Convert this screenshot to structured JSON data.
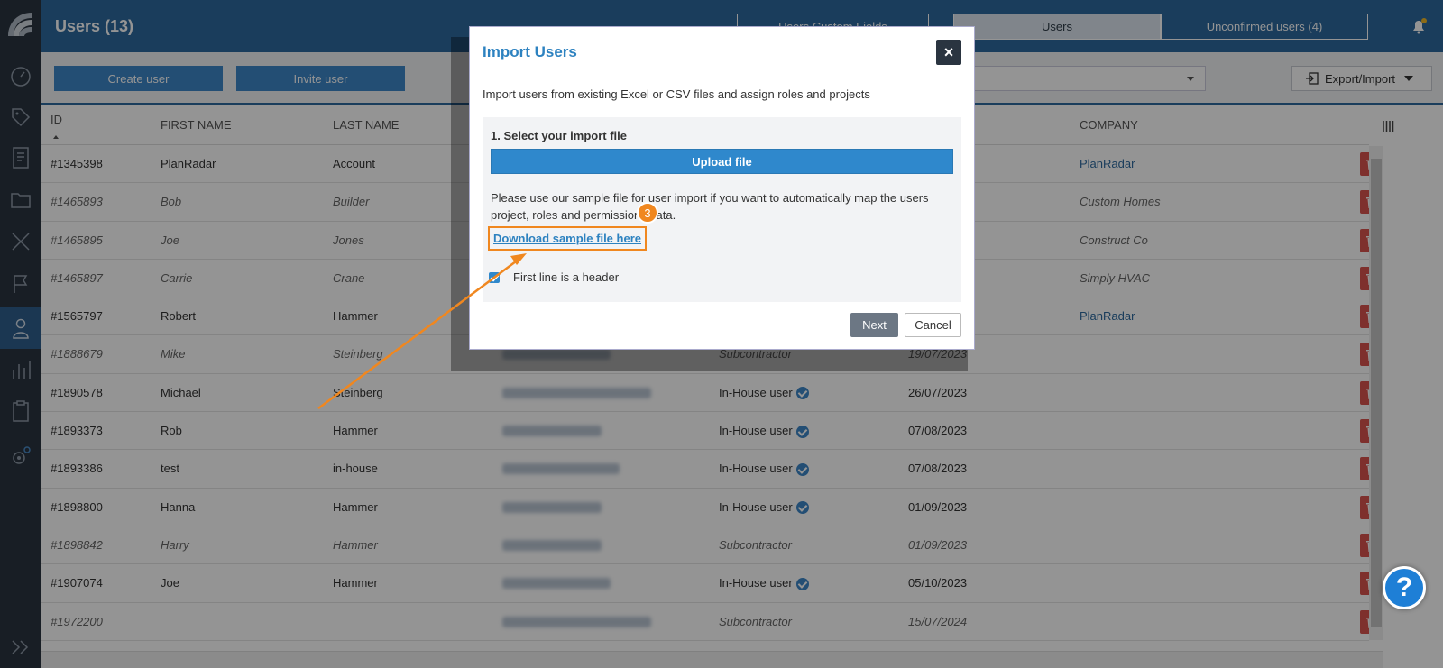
{
  "header": {
    "title": "Users (13)",
    "custom_fields_label": "Users Custom Fields",
    "tab_users": "Users",
    "tab_unconfirmed": "Unconfirmed users (4)"
  },
  "toolbar": {
    "create_user": "Create user",
    "invite_user": "Invite user",
    "export_import": "Export/Import"
  },
  "table": {
    "columns": [
      "ID",
      "FIRST NAME",
      "LAST NAME",
      "COMPANY"
    ],
    "rows": [
      {
        "id": "#1345398",
        "first": "PlanRadar",
        "last": "Account",
        "role": "",
        "date": "",
        "company": "PlanRadar",
        "italic": false,
        "verified": false
      },
      {
        "id": "#1465893",
        "first": "Bob",
        "last": "Builder",
        "role": "",
        "date": "",
        "company": "Custom Homes",
        "italic": true,
        "verified": false
      },
      {
        "id": "#1465895",
        "first": "Joe",
        "last": "Jones",
        "role": "",
        "date": "",
        "company": "Construct Co",
        "italic": true,
        "verified": false
      },
      {
        "id": "#1465897",
        "first": "Carrie",
        "last": "Crane",
        "role": "",
        "date": "",
        "company": "Simply HVAC",
        "italic": true,
        "verified": false
      },
      {
        "id": "#1565797",
        "first": "Robert",
        "last": "Hammer",
        "role": "",
        "date": "",
        "company": "PlanRadar",
        "italic": false,
        "verified": false
      },
      {
        "id": "#1888679",
        "first": "Mike",
        "last": "Steinberg",
        "role": "Subcontractor",
        "date": "19/07/2023",
        "company": "",
        "italic": true,
        "verified": false
      },
      {
        "id": "#1890578",
        "first": "Michael",
        "last": "Steinberg",
        "role": "In-House user",
        "date": "26/07/2023",
        "company": "",
        "italic": false,
        "verified": true
      },
      {
        "id": "#1893373",
        "first": "Rob",
        "last": "Hammer",
        "role": "In-House user",
        "date": "07/08/2023",
        "company": "",
        "italic": false,
        "verified": true
      },
      {
        "id": "#1893386",
        "first": "test",
        "last": "in-house",
        "role": "In-House user",
        "date": "07/08/2023",
        "company": "",
        "italic": false,
        "verified": true
      },
      {
        "id": "#1898800",
        "first": "Hanna",
        "last": "Hammer",
        "role": "In-House user",
        "date": "01/09/2023",
        "company": "",
        "italic": false,
        "verified": true
      },
      {
        "id": "#1898842",
        "first": "Harry",
        "last": "Hammer",
        "role": "Subcontractor",
        "date": "01/09/2023",
        "company": "",
        "italic": true,
        "verified": false
      },
      {
        "id": "#1907074",
        "first": "Joe",
        "last": "Hammer",
        "role": "In-House user",
        "date": "05/10/2023",
        "company": "",
        "italic": false,
        "verified": true
      },
      {
        "id": "#1972200",
        "first": "",
        "last": "",
        "role": "Subcontractor",
        "date": "15/07/2024",
        "company": "",
        "italic": true,
        "verified": false
      }
    ]
  },
  "dialog": {
    "title": "Import Users",
    "close_icon": "×",
    "description": "Import users from existing Excel or CSV files and assign roles and projects",
    "step_label": "1. Select your import file",
    "upload_label": "Upload file",
    "hint": "Please use our sample file for user import if you want to automatically map the users project, roles and permissions data.",
    "download_link": "Download sample file here",
    "step_number": "3",
    "checkbox_label": "First line is a header",
    "next_label": "Next",
    "cancel_label": "Cancel"
  },
  "help_label": "?",
  "colors": {
    "primary": "#2d6a9f",
    "sidebar": "#2a3440",
    "accent_orange": "#f0871f",
    "danger": "#d9534f"
  },
  "icons": [
    "logo",
    "dashboard-icon",
    "tag-icon",
    "document-icon",
    "folder-icon",
    "tools-icon",
    "flag-icon",
    "user-icon",
    "chart-icon",
    "clipboard-icon",
    "settings-icon",
    "expand-icon",
    "bell-icon",
    "trash-icon",
    "columns-icon",
    "export-icon"
  ]
}
